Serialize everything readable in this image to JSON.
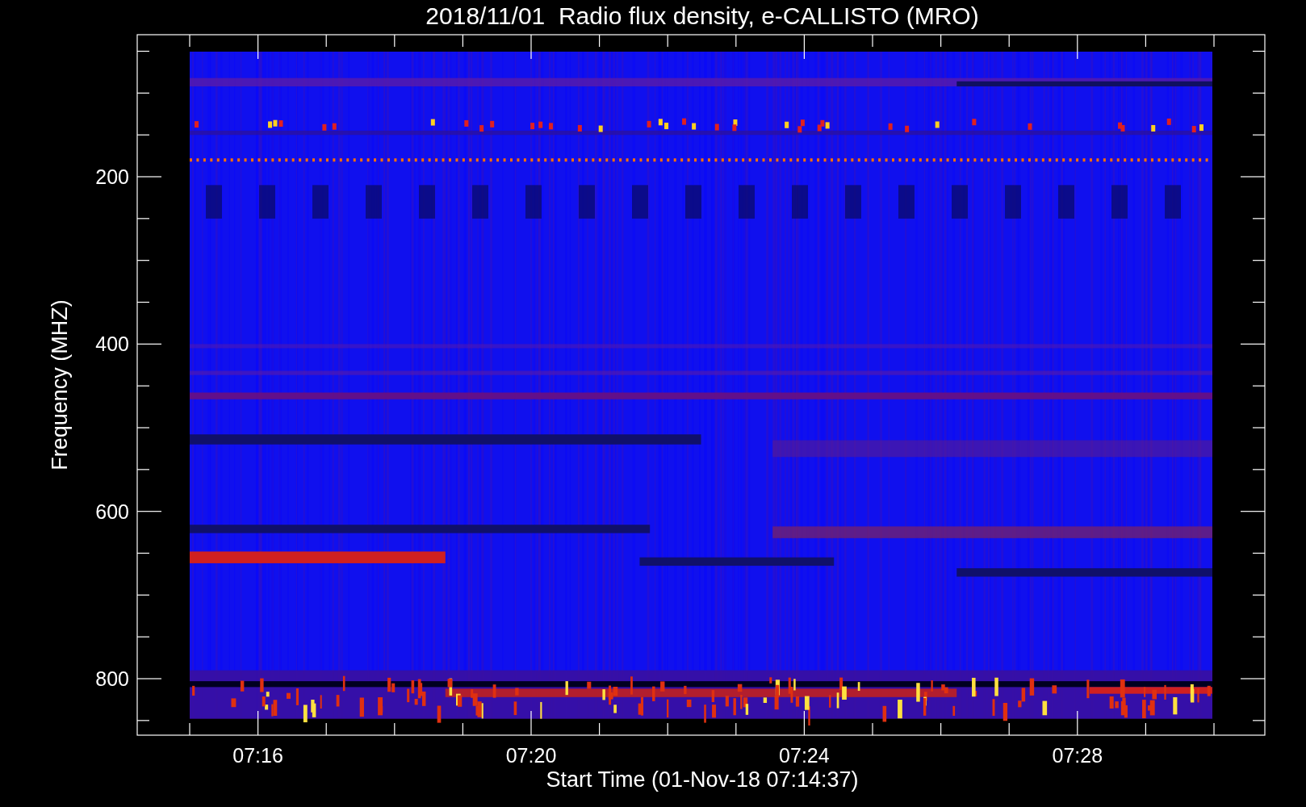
{
  "title": "2018/11/01  Radio flux density, e-CALLISTO (MRO)",
  "xlabel": "Start Time (01-Nov-18 07:14:37)",
  "ylabel": "Frequency (MHZ)",
  "xticks": [
    {
      "label": "07:16"
    },
    {
      "label": "07:20"
    },
    {
      "label": "07:24"
    },
    {
      "label": "07:28"
    }
  ],
  "yticks": [
    {
      "label": "200"
    },
    {
      "label": "400"
    },
    {
      "label": "600"
    },
    {
      "label": "800"
    }
  ]
}
